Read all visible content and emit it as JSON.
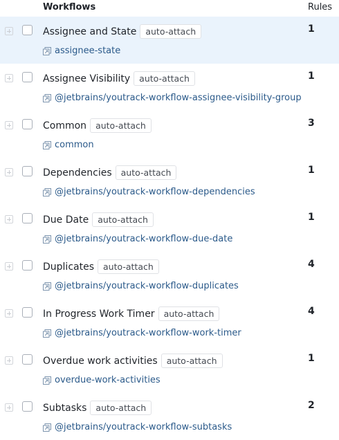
{
  "header": {
    "workflows": "Workflows",
    "rules": "Rules"
  },
  "rows": [
    {
      "name": "Assignee and State",
      "badge": "auto-attach",
      "package": "assignee-state",
      "rules": "1",
      "selected": true
    },
    {
      "name": "Assignee Visibility",
      "badge": "auto-attach",
      "package": "@jetbrains/youtrack-workflow-assignee-visibility-group",
      "rules": "1"
    },
    {
      "name": "Common",
      "badge": "auto-attach",
      "package": "common",
      "rules": "3"
    },
    {
      "name": "Dependencies",
      "badge": "auto-attach",
      "package": "@jetbrains/youtrack-workflow-dependencies",
      "rules": "1"
    },
    {
      "name": "Due Date",
      "badge": "auto-attach",
      "package": "@jetbrains/youtrack-workflow-due-date",
      "rules": "1"
    },
    {
      "name": "Duplicates",
      "badge": "auto-attach",
      "package": "@jetbrains/youtrack-workflow-duplicates",
      "rules": "4"
    },
    {
      "name": "In Progress Work Timer",
      "badge": "auto-attach",
      "package": "@jetbrains/youtrack-workflow-work-timer",
      "rules": "4"
    },
    {
      "name": "Overdue work activities",
      "badge": "auto-attach",
      "package": "overdue-work-activities",
      "rules": "1"
    },
    {
      "name": "Subtasks",
      "badge": "auto-attach",
      "package": "@jetbrains/youtrack-workflow-subtasks",
      "rules": "2"
    }
  ]
}
